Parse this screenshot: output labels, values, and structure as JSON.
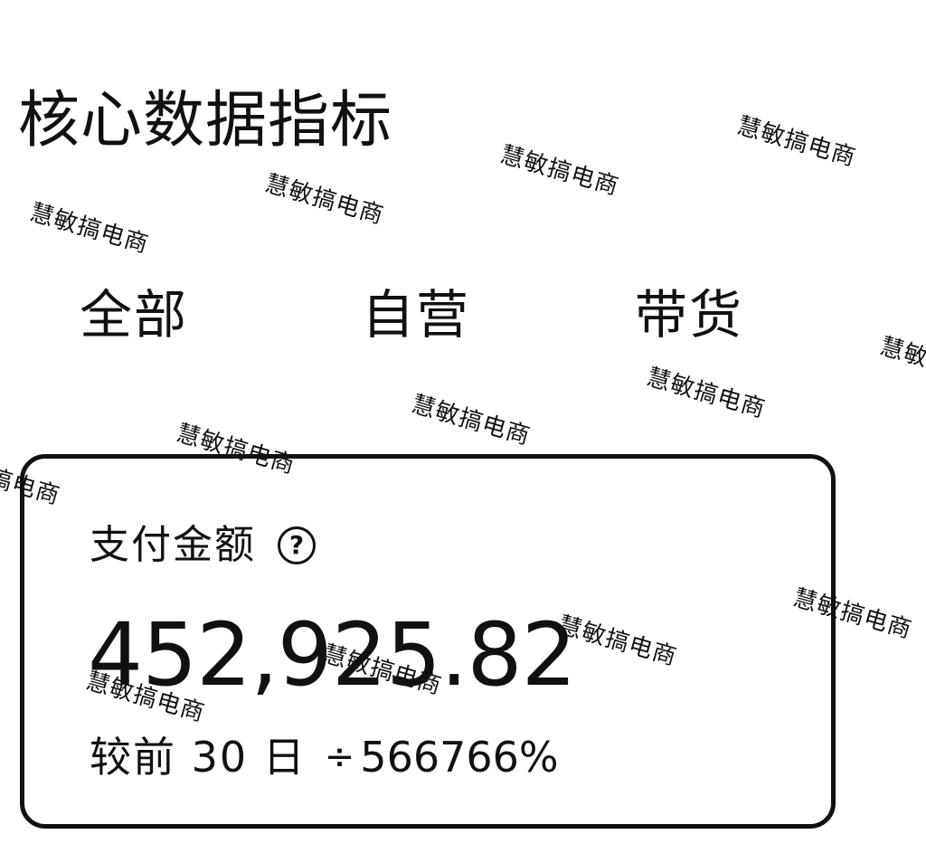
{
  "header": {
    "title": "核心数据指标"
  },
  "tabs": [
    {
      "label": "全部"
    },
    {
      "label": "自营"
    },
    {
      "label": "带货"
    }
  ],
  "metric_card": {
    "label": "支付金额",
    "help_icon": "question-circle-icon",
    "value": "452,925.82",
    "compare_label": "较前 30 日",
    "compare_arrow": "÷",
    "compare_value": "566766%"
  },
  "watermark": {
    "text": "慧敏搞电商"
  }
}
